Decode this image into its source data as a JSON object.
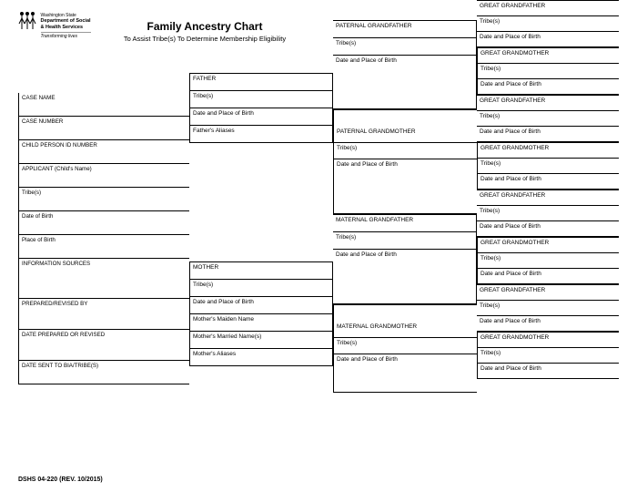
{
  "agency": {
    "state": "Washington State",
    "dept1": "Department of Social",
    "dept2": "& Health Services",
    "tagline": "Transforming lives"
  },
  "title": "Family Ancestry Chart",
  "subtitle": "To Assist Tribe(s) To Determine Membership Eligibility",
  "form_id": "DSHS 04-220 (REV. 10/2015)",
  "labels": {
    "case_name": "CASE NAME",
    "case_number": "CASE NUMBER",
    "child_id": "CHILD PERSON ID NUMBER",
    "applicant": "APPLICANT (Child's Name)",
    "tribes": "Tribe(s)",
    "dob": "Date of Birth",
    "pob": "Place of Birth",
    "info_sources": "INFORMATION SOURCES",
    "prepared_by": "PREPARED/REVISED BY",
    "date_prepared": "DATE PREPARED OR REVISED",
    "date_sent": "DATE SENT TO BIA/TRIBE(S)",
    "father": "FATHER",
    "mother": "MOTHER",
    "dpob": "Date and Place of Birth",
    "father_aliases": "Father's Aliases",
    "mother_maiden": "Mother's Maiden Name",
    "mother_married": "Mother's Married Name(s)",
    "mother_aliases": "Mother's Aliases",
    "pat_gf": "PATERNAL GRANDFATHER",
    "pat_gm": "PATERNAL GRANDMOTHER",
    "mat_gf": "MATERNAL GRANDFATHER",
    "mat_gm": "MATERNAL GRANDMOTHER",
    "ggf": "GREAT GRANDFATHER",
    "ggm": "GREAT GRANDMOTHER"
  }
}
